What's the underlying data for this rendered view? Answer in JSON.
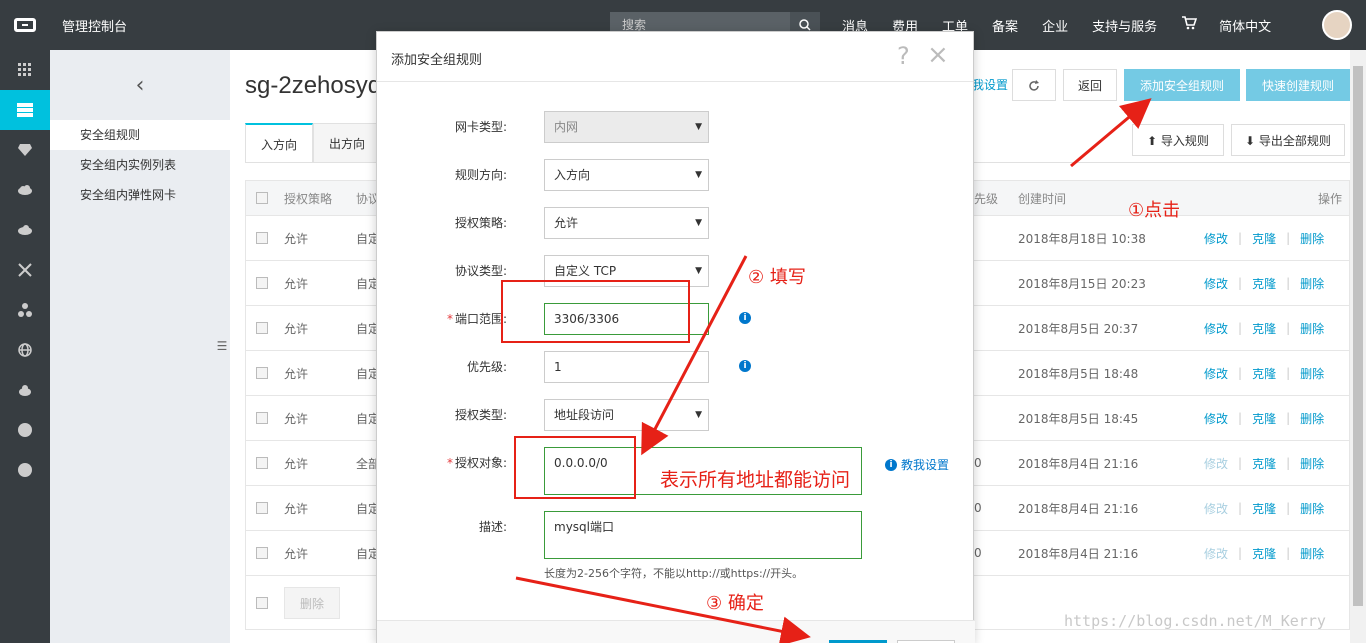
{
  "topbar": {
    "title": "管理控制台",
    "search_placeholder": "搜索",
    "nav": [
      "消息",
      "费用",
      "工单",
      "备案",
      "企业",
      "支持与服务"
    ],
    "lang": "简体中文"
  },
  "subnav": {
    "back": "‹",
    "items": [
      "安全组规则",
      "安全组内实例列表",
      "安全组内弹性网卡"
    ]
  },
  "main": {
    "sg_title": "sg-2zehosyq",
    "help_link": "我设置",
    "buttons": {
      "back": "返回",
      "add_rule": "添加安全组规则",
      "quick_create": "快速创建规则",
      "import": "导入规则",
      "export": "导出全部规则"
    },
    "tabs": [
      "入方向",
      "出方向"
    ],
    "columns": {
      "policy": "授权策略",
      "protocol": "协议",
      "priority": "先级",
      "created": "创建时间",
      "action": "操作"
    },
    "rows": [
      {
        "policy": "允许",
        "protocol": "自定",
        "priority": "",
        "created": "2018年8月18日 10:38",
        "clone_disabled": false
      },
      {
        "policy": "允许",
        "protocol": "自定",
        "priority": "",
        "created": "2018年8月15日 20:23",
        "clone_disabled": false
      },
      {
        "policy": "允许",
        "protocol": "自定",
        "priority": "",
        "created": "2018年8月5日 20:37",
        "clone_disabled": false
      },
      {
        "policy": "允许",
        "protocol": "自定",
        "priority": "",
        "created": "2018年8月5日 18:48",
        "clone_disabled": false
      },
      {
        "policy": "允许",
        "protocol": "自定",
        "priority": "",
        "created": "2018年8月5日 18:45",
        "clone_disabled": false
      },
      {
        "policy": "允许",
        "protocol": "全部",
        "priority": "0",
        "created": "2018年8月4日 21:16",
        "clone_disabled": true
      },
      {
        "policy": "允许",
        "protocol": "自定",
        "priority": "0",
        "created": "2018年8月4日 21:16",
        "clone_disabled": true
      },
      {
        "policy": "允许",
        "protocol": "自定",
        "priority": "0",
        "created": "2018年8月4日 21:16",
        "clone_disabled": true
      }
    ],
    "row_actions": {
      "edit": "修改",
      "clone": "克隆",
      "delete": "删除"
    },
    "batch_delete": "删除"
  },
  "modal": {
    "title": "添加安全组规则",
    "help": "?",
    "close": "×",
    "fields": {
      "nic_type": {
        "label": "网卡类型:",
        "value": "内网"
      },
      "direction": {
        "label": "规则方向:",
        "value": "入方向"
      },
      "policy": {
        "label": "授权策略:",
        "value": "允许"
      },
      "protocol": {
        "label": "协议类型:",
        "value": "自定义 TCP"
      },
      "port": {
        "label": "端口范围:",
        "value": "3306/3306"
      },
      "priority": {
        "label": "优先级:",
        "value": "1"
      },
      "auth_type": {
        "label": "授权类型:",
        "value": "地址段访问"
      },
      "auth_object": {
        "label": "授权对象:",
        "value": "0.0.0.0/0"
      },
      "desc": {
        "label": "描述:",
        "value": "mysql端口"
      }
    },
    "required_mark": "*",
    "hint": "长度为2-256个字符，不能以http://或https://开头。",
    "teach": "教我设置"
  },
  "annotations": {
    "step1": "①点击",
    "step2": "② 填写",
    "step3": "③ 确定",
    "note": "表示所有地址都能访问"
  },
  "watermark": "https://blog.csdn.net/M_Kerry"
}
